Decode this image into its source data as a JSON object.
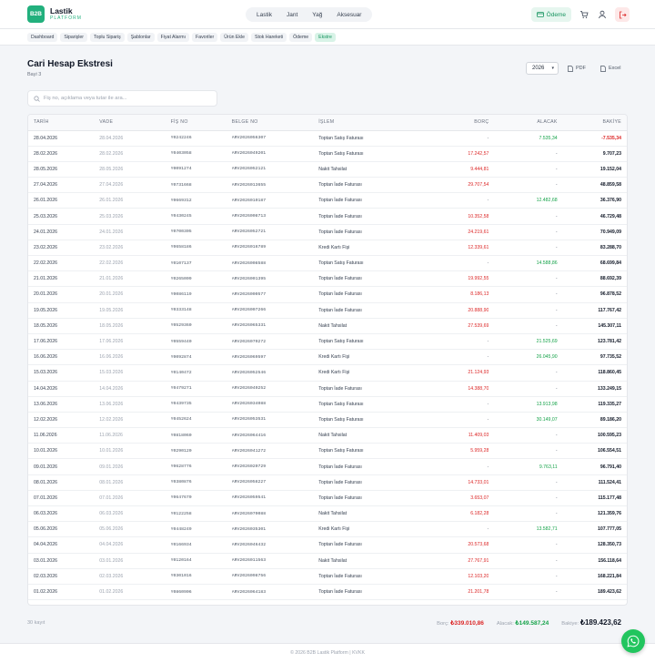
{
  "brand": {
    "logo": "B2B",
    "name": "Lastik",
    "sub": "PLATFORM"
  },
  "categories": [
    "Lastik",
    "Jant",
    "Yağ",
    "Aksesuar"
  ],
  "top_actions": {
    "payment_label": "Ödeme"
  },
  "subnav": [
    "Dashboard",
    "Siparişler",
    "Toplu Sipariş",
    "Şablonlar",
    "Fiyat Alarmı",
    "Favoriler",
    "Ürün Ekle",
    "Stok Hareketi",
    "Ödeme",
    "Ekstre"
  ],
  "page": {
    "title": "Cari Hesap Ekstresi",
    "subtitle": "Bayi 3"
  },
  "controls": {
    "year": "2026",
    "pdf": "PDF",
    "excel": "Excel",
    "search_placeholder": "Fiş no, açıklama veya tutar ile ara..."
  },
  "table": {
    "headers": [
      "TARİH",
      "VADE",
      "FİŞ NO",
      "BELGE NO",
      "İŞLEM",
      "BORÇ",
      "ALACAK",
      "BAKİYE"
    ],
    "rows": [
      [
        "28.04.2026",
        "28.04.2026",
        "Y0242246",
        "ARV2026056307",
        "Toptan Satış Faturası",
        "-",
        "7.535,34",
        "-7.535,34"
      ],
      [
        "28.02.2026",
        "28.02.2026",
        "Y0403058",
        "ARV2026049201",
        "Toptan Satış Faturası",
        "17.242,57",
        "-",
        "9.707,23"
      ],
      [
        "28.05.2026",
        "28.05.2026",
        "Y0091274",
        "ARV2026052121",
        "Nakit Tahsilat",
        "9.444,81",
        "-",
        "19.152,04"
      ],
      [
        "27.04.2026",
        "27.04.2026",
        "Y0731668",
        "ARV2026013655",
        "Toptan İade Faturası",
        "29.707,54",
        "-",
        "48.859,58"
      ],
      [
        "26.01.2026",
        "26.01.2026",
        "Y0669312",
        "ARV2026010187",
        "Toptan İade Faturası",
        "-",
        "12.482,68",
        "36.376,90"
      ],
      [
        "25.03.2026",
        "25.03.2026",
        "Y0430245",
        "ARV2026008713",
        "Toptan İade Faturası",
        "10.352,58",
        "-",
        "46.729,48"
      ],
      [
        "24.01.2026",
        "24.01.2026",
        "Y0700305",
        "ARV2026052721",
        "Toptan İade Faturası",
        "24.219,61",
        "-",
        "70.949,09"
      ],
      [
        "23.02.2026",
        "23.02.2026",
        "Y0658186",
        "ARV2026016789",
        "Kredi Kartı Fişi",
        "12.339,61",
        "-",
        "83.288,70"
      ],
      [
        "22.02.2026",
        "22.02.2026",
        "Y0107137",
        "ARV2026008588",
        "Toptan Satış Faturası",
        "-",
        "14.588,86",
        "68.699,84"
      ],
      [
        "21.01.2026",
        "21.01.2026",
        "Y0265009",
        "ARV2026001395",
        "Toptan İade Faturası",
        "19.992,55",
        "-",
        "88.692,39"
      ],
      [
        "20.01.2026",
        "20.01.2026",
        "Y0086119",
        "ARV2026000577",
        "Toptan İade Faturası",
        "8.186,13",
        "-",
        "96.878,52"
      ],
      [
        "19.05.2026",
        "19.05.2026",
        "Y0333148",
        "ARV2026007266",
        "Toptan İade Faturası",
        "20.888,90",
        "-",
        "117.767,42"
      ],
      [
        "18.05.2026",
        "18.05.2026",
        "Y0529360",
        "ARV2026065331",
        "Nakit Tahsilat",
        "27.539,69",
        "-",
        "145.307,11"
      ],
      [
        "17.06.2026",
        "17.06.2026",
        "Y0559440",
        "ARV2026070272",
        "Toptan Satış Faturası",
        "-",
        "21.525,69",
        "123.781,42"
      ],
      [
        "16.06.2026",
        "16.06.2026",
        "Y0092874",
        "ARV2026069597",
        "Kredi Kartı Fişi",
        "-",
        "26.045,90",
        "97.735,52"
      ],
      [
        "15.03.2026",
        "15.03.2026",
        "Y0140472",
        "ARV2026052546",
        "Kredi Kartı Fişi",
        "21.124,93",
        "-",
        "118.860,45"
      ],
      [
        "14.04.2026",
        "14.04.2026",
        "Y0479271",
        "ARV2026040252",
        "Toptan İade Faturası",
        "14.388,70",
        "-",
        "133.249,15"
      ],
      [
        "13.06.2026",
        "13.06.2026",
        "Y0439735",
        "ARV2026034088",
        "Toptan Satış Faturası",
        "-",
        "13.913,98",
        "119.335,27"
      ],
      [
        "12.02.2026",
        "12.02.2026",
        "Y0452624",
        "ARV2026053531",
        "Toptan Satış Faturası",
        "-",
        "30.149,07",
        "89.186,20"
      ],
      [
        "11.06.2026",
        "11.06.2026",
        "Y0818060",
        "ARV2026064416",
        "Nakit Tahsilat",
        "11.409,03",
        "-",
        "100.595,23"
      ],
      [
        "10.01.2026",
        "10.01.2026",
        "Y0290120",
        "ARV2026041272",
        "Toptan Satış Faturası",
        "5.959,28",
        "-",
        "106.554,51"
      ],
      [
        "09.01.2026",
        "09.01.2026",
        "Y0628776",
        "ARV2026020729",
        "Toptan İade Faturası",
        "-",
        "9.763,11",
        "96.791,40"
      ],
      [
        "08.01.2026",
        "08.01.2026",
        "Y0380876",
        "ARV2026058227",
        "Toptan İade Faturası",
        "14.733,01",
        "-",
        "111.524,41"
      ],
      [
        "07.01.2026",
        "07.01.2026",
        "Y0647670",
        "ARV2026059541",
        "Toptan İade Faturası",
        "3.653,07",
        "-",
        "115.177,48"
      ],
      [
        "06.03.2026",
        "06.03.2026",
        "Y0122258",
        "ARV2026070088",
        "Nakit Tahsilat",
        "6.182,28",
        "-",
        "121.359,76"
      ],
      [
        "05.06.2026",
        "05.06.2026",
        "Y0448249",
        "ARV2026035301",
        "Kredi Kartı Fişi",
        "-",
        "13.582,71",
        "107.777,05"
      ],
      [
        "04.04.2026",
        "04.04.2026",
        "Y0166934",
        "ARV2026046432",
        "Toptan İade Faturası",
        "20.573,68",
        "-",
        "128.350,73"
      ],
      [
        "03.01.2026",
        "03.01.2026",
        "Y0120164",
        "ARV2026011563",
        "Nakit Tahsilat",
        "27.767,91",
        "-",
        "156.118,64"
      ],
      [
        "02.03.2026",
        "02.03.2026",
        "Y0301016",
        "ARV2026098756",
        "Toptan İade Faturası",
        "12.103,20",
        "-",
        "168.221,84"
      ],
      [
        "01.02.2026",
        "01.02.2026",
        "Y0860906",
        "ARV2026064183",
        "Toptan İade Faturası",
        "21.201,78",
        "-",
        "189.423,62"
      ]
    ]
  },
  "summary": {
    "record_count": "30 kayıt",
    "borc_label": "Borç:",
    "borc_value": "₺339.010,86",
    "alacak_label": "Alacak:",
    "alacak_value": "₺149.587,24",
    "bakiye_label": "Bakiye:",
    "bakiye_value": "₺189.423,62"
  },
  "footer": {
    "text": "© 2026 B2B Lastik Platform  |  KVKK"
  },
  "colors": {
    "accent": "#22b07d",
    "debit": "#dc2626",
    "credit": "#16a34a",
    "whatsapp": "#22c55e"
  }
}
